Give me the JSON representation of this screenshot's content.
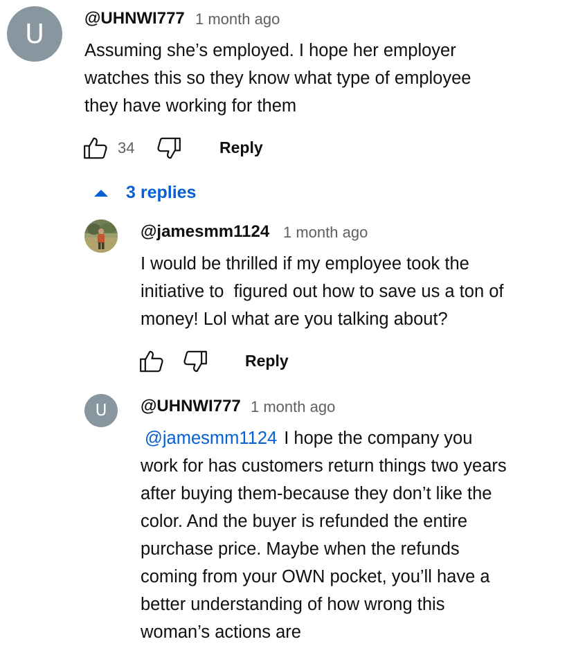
{
  "comments": [
    {
      "avatar_letter": "U",
      "handle": "@UHNWI777",
      "time": "1 month ago",
      "lines": [
        "Assuming she’s employed. I hope her employer",
        "watches this so they know what type of employee",
        "they have working for them"
      ],
      "likes": "34",
      "reply_label": "Reply",
      "replies_toggle": "3 replies"
    }
  ],
  "replies": [
    {
      "avatar": "photo-avatar",
      "handle": "@jamesmm1124",
      "time": "1 month ago",
      "lines": [
        "I would be thrilled if my employee took the",
        "initiative to  figured out how to save us a ton of",
        "money! Lol what are you talking about?"
      ],
      "reply_label": "Reply"
    },
    {
      "avatar_letter": "U",
      "handle": "@UHNWI777",
      "time": "1 month ago",
      "mention": "@jamesmm1124",
      "first_line_rest": "I hope the company you",
      "lines": [
        "work for has customers return things two years",
        "after buying them-because they don’t like the",
        "color. And the buyer is refunded the entire",
        "purchase price. Maybe when the refunds",
        "coming from your OWN pocket, you’ll have a",
        "better understanding of how wrong this",
        "woman’s actions are"
      ]
    }
  ],
  "colors": {
    "link_blue": "#065fd4",
    "meta_gray": "#606060",
    "avatar_gray": "#8896a0",
    "text": "#0f0f0f"
  },
  "icons": [
    "thumb-up-icon",
    "thumb-down-icon",
    "caret-up-icon"
  ]
}
